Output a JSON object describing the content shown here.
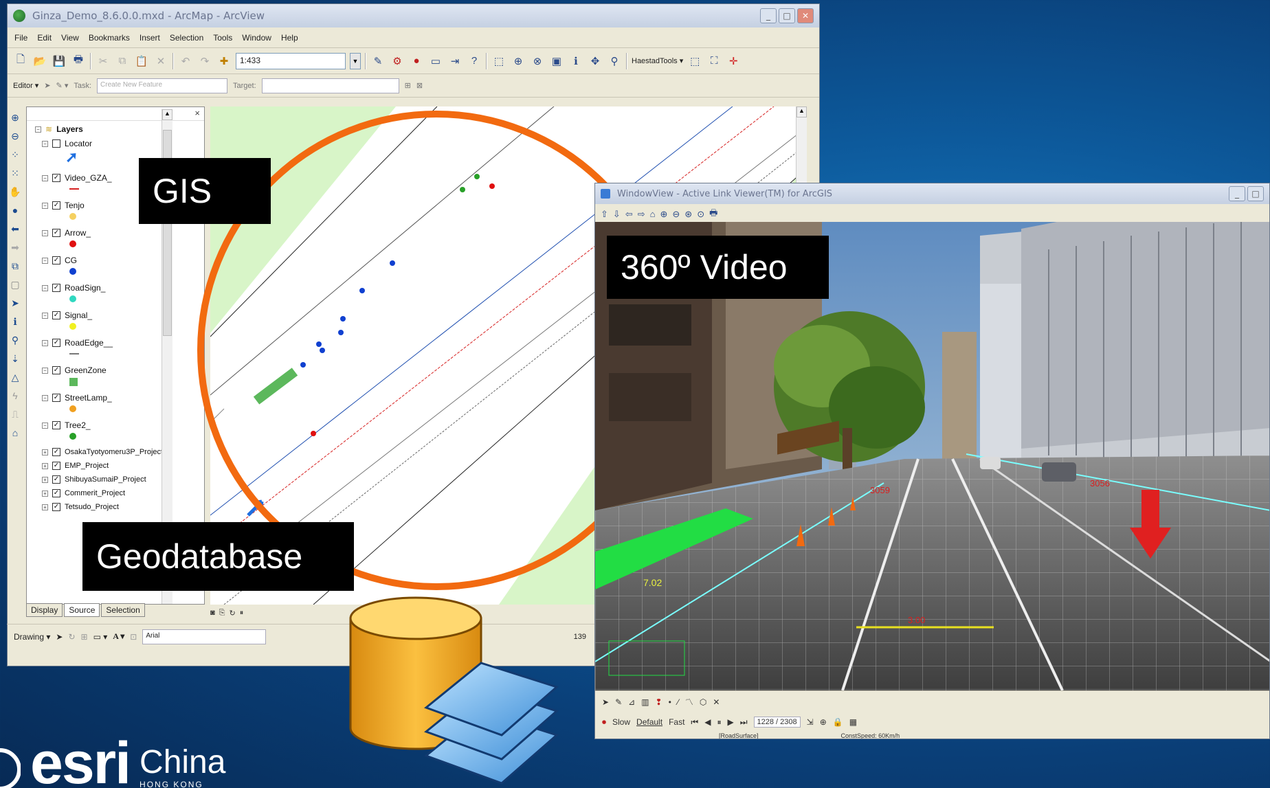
{
  "arcmap": {
    "title": "Ginza_Demo_8.6.0.0.mxd - ArcMap - ArcView",
    "menu": [
      "File",
      "Edit",
      "View",
      "Bookmarks",
      "Insert",
      "Selection",
      "Tools",
      "Window",
      "Help"
    ],
    "scale_value": "1:433",
    "editor_label": "Editor ▾",
    "task_label": "Task:",
    "task_value": "Create New Feature",
    "target_label": "Target:",
    "haestad_label": "HaestadTools ▾",
    "drawing_label": "Drawing ▾",
    "font_value": "Arial",
    "status_value": "139"
  },
  "toc": {
    "root": "Layers",
    "layers": [
      {
        "name": "Locator",
        "checked": false,
        "symbol": "arrow",
        "color": "#1f6fe0"
      },
      {
        "name": "Video_GZA_",
        "checked": true,
        "symbol": "line",
        "color": "#d62020"
      },
      {
        "name": "Tenjo",
        "checked": true,
        "symbol": "dot",
        "color": "#f5d060"
      },
      {
        "name": "Arrow_",
        "checked": true,
        "symbol": "dot",
        "color": "#e01010"
      },
      {
        "name": "CG",
        "checked": true,
        "symbol": "dot",
        "color": "#1040d0"
      },
      {
        "name": "RoadSign_",
        "checked": true,
        "symbol": "dot",
        "color": "#30d8c0"
      },
      {
        "name": "Signal_",
        "checked": true,
        "symbol": "dot",
        "color": "#f0f020"
      },
      {
        "name": "RoadEdge__",
        "checked": true,
        "symbol": "line",
        "color": "#777777"
      },
      {
        "name": "GreenZone",
        "checked": true,
        "symbol": "square",
        "color": "#5cb85c"
      },
      {
        "name": "StreetLamp_",
        "checked": true,
        "symbol": "dot",
        "color": "#f0a020"
      },
      {
        "name": "Tree2_",
        "checked": true,
        "symbol": "dot",
        "color": "#28a028"
      }
    ],
    "groups": [
      "OsakaTyotyomeru3P_Project",
      "EMP_Project",
      "ShibuyaSumaiP_Project",
      "Commerit_Project",
      "Tetsudo_Project"
    ],
    "tabs": [
      "Display",
      "Source",
      "Selection"
    ]
  },
  "video": {
    "title": "WindowView - Active Link Viewer(TM) for ArcGIS",
    "speed_slow": "Slow",
    "speed_default": "Default",
    "speed_fast": "Fast",
    "frame": "1228 / 2308",
    "status_left": "[RoadSurface]",
    "status_right": "ConstSpeed: 60Km/h",
    "overlay_values": [
      "3059",
      "3056",
      "7.02",
      "3.00"
    ]
  },
  "labels": {
    "gis": "GIS",
    "video": "360º Video",
    "geodatabase": "Geodatabase"
  },
  "logo": {
    "brand": "esri",
    "region": "China",
    "sub": "HONG KONG"
  },
  "colors": {
    "orange_ring": "#f26a10",
    "map_green": "#d8f5c8",
    "video_green": "#22dd44"
  }
}
